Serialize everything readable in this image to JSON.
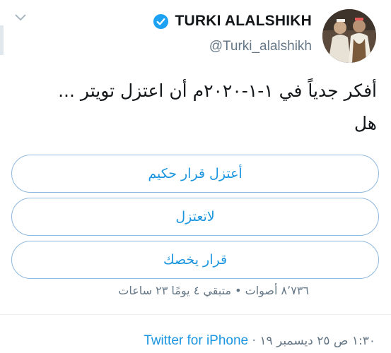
{
  "user": {
    "name": "TURKI ALALSHIKH",
    "handle": "@Turki_alalshikh",
    "verified": true
  },
  "tweet": {
    "text_line1": "أفكر جدياً في ١-١-٢٠٢٠م أن اعتزل تويتر ...",
    "text_line2": "هل"
  },
  "poll": {
    "options": [
      "أعتزل قرار حكيم",
      "لاتعتزل",
      "قرار يخصك"
    ],
    "meta": "٨٬٧٣٦ أصوات • متبقي ٤ يومًا ٢٣ ساعات"
  },
  "footer": {
    "time": "١:٣٠ ص",
    "date": "٢٥ ديسمبر ١٩",
    "separator": "·",
    "source": "Twitter for iPhone"
  },
  "colors": {
    "link": "#1b95e0",
    "muted": "#657786",
    "poll_border": "#8fb8e0",
    "verified": "#1da1f2"
  }
}
